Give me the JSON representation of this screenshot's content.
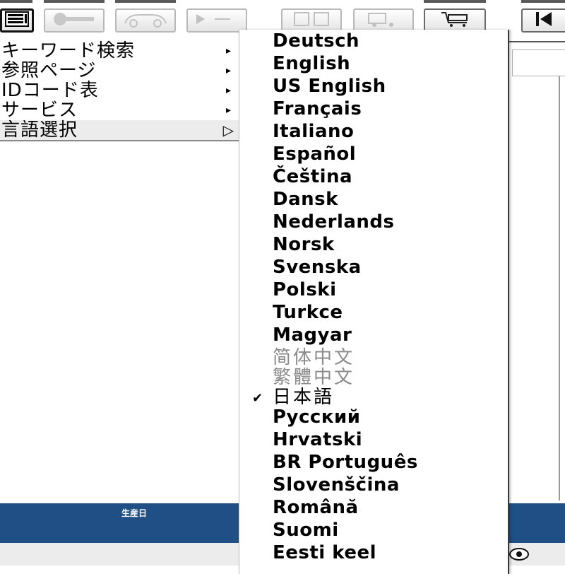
{
  "context_menu": {
    "items": [
      {
        "label": "キーワード検索",
        "arrow": "▸"
      },
      {
        "label": "参照ページ",
        "arrow": "▸"
      },
      {
        "label": "IDコード表",
        "arrow": "▸"
      },
      {
        "label": "サービス",
        "arrow": "▸"
      },
      {
        "label": "言語選択",
        "arrow": "▷"
      }
    ]
  },
  "language_menu": {
    "checkmark": "✔",
    "items": [
      {
        "label": "Deutsch"
      },
      {
        "label": "English"
      },
      {
        "label": "US English"
      },
      {
        "label": "Français"
      },
      {
        "label": "Italiano"
      },
      {
        "label": "Español"
      },
      {
        "label": "Čeština"
      },
      {
        "label": "Dansk"
      },
      {
        "label": "Nederlands"
      },
      {
        "label": "Norsk"
      },
      {
        "label": "Svenska"
      },
      {
        "label": "Polski"
      },
      {
        "label": "Turkce"
      },
      {
        "label": "Magyar"
      },
      {
        "label": "简体中文"
      },
      {
        "label": "繁體中文"
      },
      {
        "label": "日本語",
        "checked": true
      },
      {
        "label": "Русский"
      },
      {
        "label": "Hrvatski"
      },
      {
        "label": "BR Português"
      },
      {
        "label": "Slovenščina"
      },
      {
        "label": "Română"
      },
      {
        "label": "Suomi"
      },
      {
        "label": "Eesti keel"
      }
    ]
  },
  "bottom_bar": {
    "label": "生産日"
  },
  "colors": {
    "blue_bar": "#1f4f84"
  },
  "icons": [
    "menu-icon",
    "key-icon",
    "vehicle-icon",
    "play-icon",
    "document-icon",
    "truck-icon",
    "cart-icon",
    "skip-back-icon",
    "eye-icon"
  ]
}
